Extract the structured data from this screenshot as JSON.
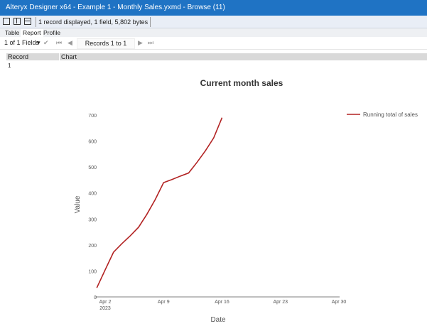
{
  "window": {
    "title": "Alteryx Designer x64 - Example 1 - Monthly Sales.yxmd - Browse (11)"
  },
  "info": {
    "text": "1 record displayed, 1 field, 5,802 bytes"
  },
  "tabs": [
    "Table",
    "Report",
    "Profile"
  ],
  "toolbar": {
    "fields": "1 of 1 Fields",
    "records": "Records 1 to 1"
  },
  "grid": {
    "headers": [
      "Record",
      "Chart"
    ],
    "row": "1"
  },
  "colors": {
    "accent": "#1f73c4",
    "series": "#b22222"
  },
  "chart_data": {
    "type": "line",
    "title": "Current month sales",
    "xlabel": "Date",
    "ylabel": "Value",
    "x_ticks": [
      "Apr 2",
      "Apr 9",
      "Apr 16",
      "Apr 23",
      "Apr 30"
    ],
    "x_tick_sub": "2023",
    "y_ticks": [
      "0",
      "100",
      "200",
      "300",
      "400",
      "500",
      "600",
      "700"
    ],
    "ylim": [
      0,
      700
    ],
    "xlim_days": [
      1,
      30
    ],
    "series": [
      {
        "name": "Running total of sales",
        "x_day": [
          1,
          2,
          3,
          4,
          5,
          6,
          7,
          8,
          9,
          10,
          11,
          12,
          13,
          14,
          15,
          16
        ],
        "values": [
          35,
          104,
          172,
          205,
          235,
          268,
          318,
          375,
          440,
          452,
          465,
          477,
          518,
          562,
          612,
          690
        ]
      }
    ],
    "legend": "top-right"
  }
}
